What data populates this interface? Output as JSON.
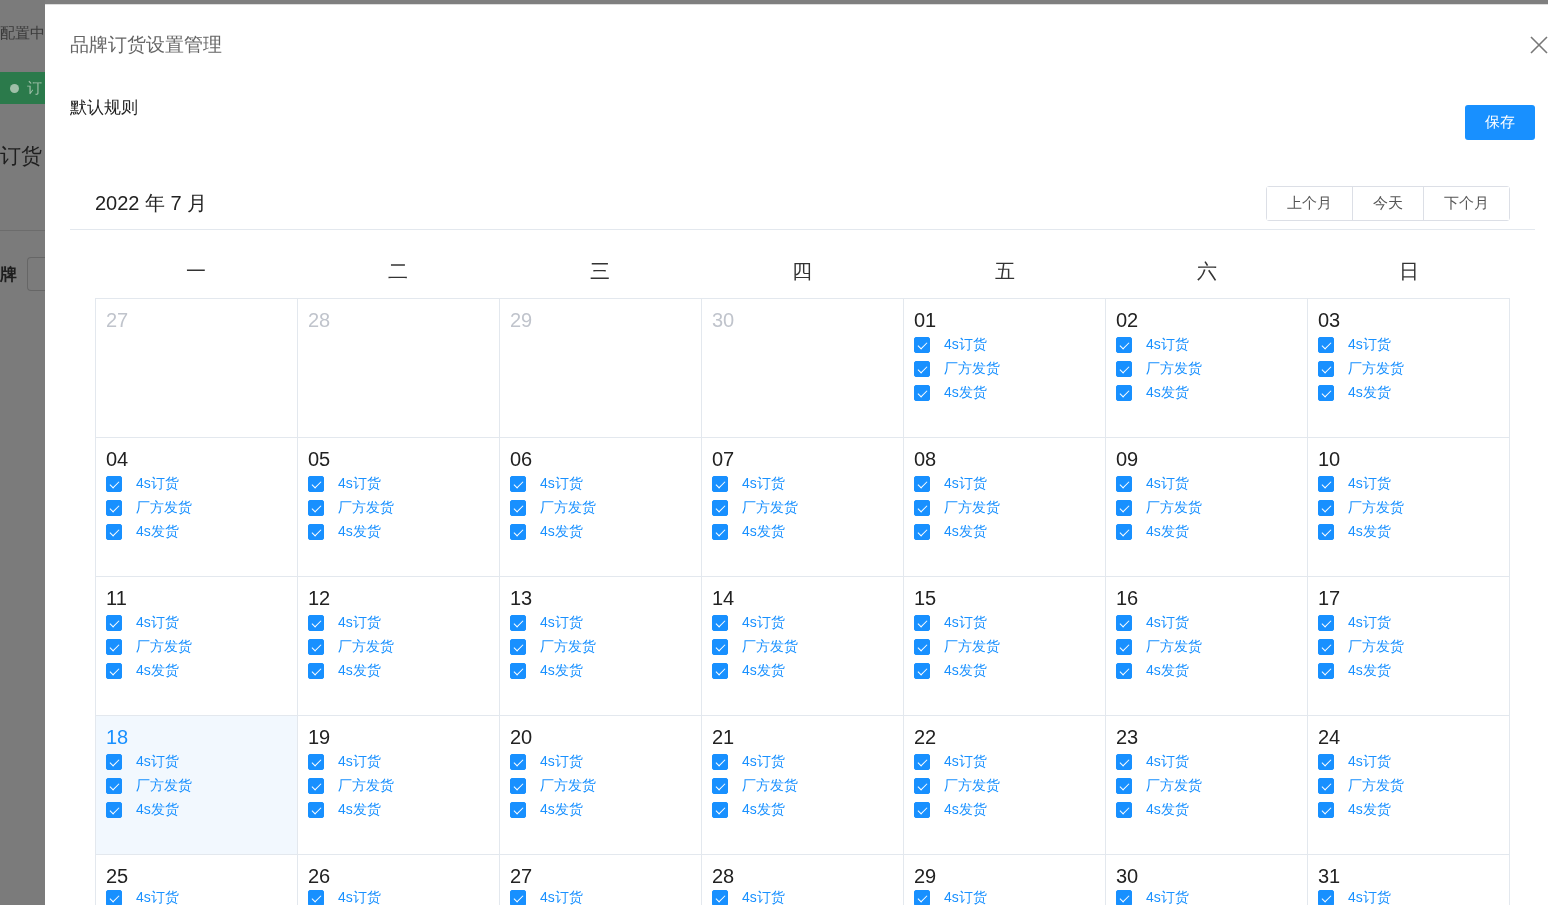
{
  "background_page": {
    "header_text": "配置中",
    "tag": {
      "label": "订"
    },
    "heading": "订货",
    "filter_label": "牌"
  },
  "dialog": {
    "title": "品牌订货设置管理",
    "section_label": "默认规则",
    "save_button": "保存",
    "calendar": {
      "month_label": "2022 年 7 月",
      "nav_buttons": [
        "上个月",
        "今天",
        "下个月"
      ],
      "weekdays": [
        "一",
        "二",
        "三",
        "四",
        "五",
        "六",
        "日"
      ],
      "weeks": [
        [
          {
            "day": "27",
            "other_month": true,
            "selected": false
          },
          {
            "day": "28",
            "other_month": true,
            "selected": false
          },
          {
            "day": "29",
            "other_month": true,
            "selected": false
          },
          {
            "day": "30",
            "other_month": true,
            "selected": false
          },
          {
            "day": "01",
            "other_month": false,
            "selected": false,
            "options": [
              {
                "label": "4s订货",
                "checked": true
              },
              {
                "label": "厂方发货",
                "checked": true
              },
              {
                "label": "4s发货",
                "checked": true
              }
            ]
          },
          {
            "day": "02",
            "other_month": false,
            "selected": false,
            "options": [
              {
                "label": "4s订货",
                "checked": true
              },
              {
                "label": "厂方发货",
                "checked": true
              },
              {
                "label": "4s发货",
                "checked": true
              }
            ]
          },
          {
            "day": "03",
            "other_month": false,
            "selected": false,
            "options": [
              {
                "label": "4s订货",
                "checked": true
              },
              {
                "label": "厂方发货",
                "checked": true
              },
              {
                "label": "4s发货",
                "checked": true
              }
            ]
          }
        ],
        [
          {
            "day": "04",
            "other_month": false,
            "selected": false,
            "options": [
              {
                "label": "4s订货",
                "checked": true
              },
              {
                "label": "厂方发货",
                "checked": true
              },
              {
                "label": "4s发货",
                "checked": true
              }
            ]
          },
          {
            "day": "05",
            "other_month": false,
            "selected": false,
            "options": [
              {
                "label": "4s订货",
                "checked": true
              },
              {
                "label": "厂方发货",
                "checked": true
              },
              {
                "label": "4s发货",
                "checked": true
              }
            ]
          },
          {
            "day": "06",
            "other_month": false,
            "selected": false,
            "options": [
              {
                "label": "4s订货",
                "checked": true
              },
              {
                "label": "厂方发货",
                "checked": true
              },
              {
                "label": "4s发货",
                "checked": true
              }
            ]
          },
          {
            "day": "07",
            "other_month": false,
            "selected": false,
            "options": [
              {
                "label": "4s订货",
                "checked": true
              },
              {
                "label": "厂方发货",
                "checked": true
              },
              {
                "label": "4s发货",
                "checked": true
              }
            ]
          },
          {
            "day": "08",
            "other_month": false,
            "selected": false,
            "options": [
              {
                "label": "4s订货",
                "checked": true
              },
              {
                "label": "厂方发货",
                "checked": true
              },
              {
                "label": "4s发货",
                "checked": true
              }
            ]
          },
          {
            "day": "09",
            "other_month": false,
            "selected": false,
            "options": [
              {
                "label": "4s订货",
                "checked": true
              },
              {
                "label": "厂方发货",
                "checked": true
              },
              {
                "label": "4s发货",
                "checked": true
              }
            ]
          },
          {
            "day": "10",
            "other_month": false,
            "selected": false,
            "options": [
              {
                "label": "4s订货",
                "checked": true
              },
              {
                "label": "厂方发货",
                "checked": true
              },
              {
                "label": "4s发货",
                "checked": true
              }
            ]
          }
        ],
        [
          {
            "day": "11",
            "other_month": false,
            "selected": false,
            "options": [
              {
                "label": "4s订货",
                "checked": true
              },
              {
                "label": "厂方发货",
                "checked": true
              },
              {
                "label": "4s发货",
                "checked": true
              }
            ]
          },
          {
            "day": "12",
            "other_month": false,
            "selected": false,
            "options": [
              {
                "label": "4s订货",
                "checked": true
              },
              {
                "label": "厂方发货",
                "checked": true
              },
              {
                "label": "4s发货",
                "checked": true
              }
            ]
          },
          {
            "day": "13",
            "other_month": false,
            "selected": false,
            "options": [
              {
                "label": "4s订货",
                "checked": true
              },
              {
                "label": "厂方发货",
                "checked": true
              },
              {
                "label": "4s发货",
                "checked": true
              }
            ]
          },
          {
            "day": "14",
            "other_month": false,
            "selected": false,
            "options": [
              {
                "label": "4s订货",
                "checked": true
              },
              {
                "label": "厂方发货",
                "checked": true
              },
              {
                "label": "4s发货",
                "checked": true
              }
            ]
          },
          {
            "day": "15",
            "other_month": false,
            "selected": false,
            "options": [
              {
                "label": "4s订货",
                "checked": true
              },
              {
                "label": "厂方发货",
                "checked": true
              },
              {
                "label": "4s发货",
                "checked": true
              }
            ]
          },
          {
            "day": "16",
            "other_month": false,
            "selected": false,
            "options": [
              {
                "label": "4s订货",
                "checked": true
              },
              {
                "label": "厂方发货",
                "checked": true
              },
              {
                "label": "4s发货",
                "checked": true
              }
            ]
          },
          {
            "day": "17",
            "other_month": false,
            "selected": false,
            "options": [
              {
                "label": "4s订货",
                "checked": true
              },
              {
                "label": "厂方发货",
                "checked": true
              },
              {
                "label": "4s发货",
                "checked": true
              }
            ]
          }
        ],
        [
          {
            "day": "18",
            "other_month": false,
            "selected": true,
            "options": [
              {
                "label": "4s订货",
                "checked": true
              },
              {
                "label": "厂方发货",
                "checked": true
              },
              {
                "label": "4s发货",
                "checked": true
              }
            ]
          },
          {
            "day": "19",
            "other_month": false,
            "selected": false,
            "options": [
              {
                "label": "4s订货",
                "checked": true
              },
              {
                "label": "厂方发货",
                "checked": true
              },
              {
                "label": "4s发货",
                "checked": true
              }
            ]
          },
          {
            "day": "20",
            "other_month": false,
            "selected": false,
            "options": [
              {
                "label": "4s订货",
                "checked": true
              },
              {
                "label": "厂方发货",
                "checked": true
              },
              {
                "label": "4s发货",
                "checked": true
              }
            ]
          },
          {
            "day": "21",
            "other_month": false,
            "selected": false,
            "options": [
              {
                "label": "4s订货",
                "checked": true
              },
              {
                "label": "厂方发货",
                "checked": true
              },
              {
                "label": "4s发货",
                "checked": true
              }
            ]
          },
          {
            "day": "22",
            "other_month": false,
            "selected": false,
            "options": [
              {
                "label": "4s订货",
                "checked": true
              },
              {
                "label": "厂方发货",
                "checked": true
              },
              {
                "label": "4s发货",
                "checked": true
              }
            ]
          },
          {
            "day": "23",
            "other_month": false,
            "selected": false,
            "options": [
              {
                "label": "4s订货",
                "checked": true
              },
              {
                "label": "厂方发货",
                "checked": true
              },
              {
                "label": "4s发货",
                "checked": true
              }
            ]
          },
          {
            "day": "24",
            "other_month": false,
            "selected": false,
            "options": [
              {
                "label": "4s订货",
                "checked": true
              },
              {
                "label": "厂方发货",
                "checked": true
              },
              {
                "label": "4s发货",
                "checked": true
              }
            ]
          }
        ],
        [
          {
            "day": "25",
            "other_month": false,
            "selected": false,
            "options": [
              {
                "label": "4s订货",
                "checked": true
              }
            ]
          },
          {
            "day": "26",
            "other_month": false,
            "selected": false,
            "options": [
              {
                "label": "4s订货",
                "checked": true
              }
            ]
          },
          {
            "day": "27",
            "other_month": false,
            "selected": false,
            "options": [
              {
                "label": "4s订货",
                "checked": true
              }
            ]
          },
          {
            "day": "28",
            "other_month": false,
            "selected": false,
            "options": [
              {
                "label": "4s订货",
                "checked": true
              }
            ]
          },
          {
            "day": "29",
            "other_month": false,
            "selected": false,
            "options": [
              {
                "label": "4s订货",
                "checked": true
              }
            ]
          },
          {
            "day": "30",
            "other_month": false,
            "selected": false,
            "options": [
              {
                "label": "4s订货",
                "checked": true
              }
            ]
          },
          {
            "day": "31",
            "other_month": false,
            "selected": false,
            "options": [
              {
                "label": "4s订货",
                "checked": true
              }
            ]
          }
        ]
      ]
    }
  }
}
